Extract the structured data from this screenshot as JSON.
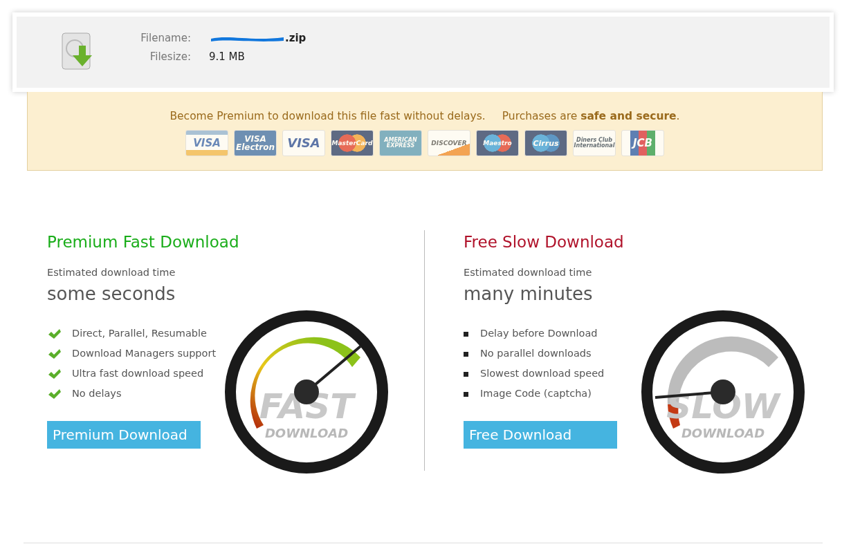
{
  "file": {
    "filename_label": "Filename:",
    "filename": ".zip",
    "filesize_label": "Filesize:",
    "filesize": "9.1 MB"
  },
  "premium_banner": {
    "message": "Become Premium to download this file fast without delays.",
    "security": "Purchases are **safe and secure**.",
    "cards": [
      {
        "kind": "visa-stripe",
        "lines": [
          "VISA"
        ]
      },
      {
        "kind": "visa-electron",
        "lines": [
          "VISA",
          "Electron"
        ]
      },
      {
        "kind": "visa-plain",
        "lines": [
          "VISA"
        ]
      },
      {
        "kind": "mastercard",
        "lines": [
          "MasterCard"
        ]
      },
      {
        "kind": "amex",
        "lines": [
          "AMERICAN",
          "EXPRESS"
        ]
      },
      {
        "kind": "discover",
        "lines": [
          "DISCOVER"
        ]
      },
      {
        "kind": "maestro",
        "lines": [
          "Maestro"
        ]
      },
      {
        "kind": "cirrus",
        "lines": [
          "Cirrus"
        ]
      },
      {
        "kind": "diners",
        "lines": [
          "Diners Club",
          "International"
        ]
      },
      {
        "kind": "jcb",
        "lines": [
          "JCB"
        ]
      }
    ]
  },
  "options": [
    {
      "kind": "fast",
      "title": "Premium Fast Download",
      "color": "#1aad1a",
      "estimate_label": "Estimated download time",
      "estimate": "some seconds",
      "features": [
        "Direct, Parallel, Resumable",
        "Download Managers support",
        "Ultra fast download speed",
        "No delays"
      ],
      "button": "Premium Download",
      "gauge_word": "FAST",
      "gauge_caption": "DOWNLOAD"
    },
    {
      "kind": "slow",
      "title": "Free Slow Download",
      "color": "#b0122a",
      "estimate_label": "Estimated download time",
      "estimate": "many minutes",
      "features": [
        "Delay before Download",
        "No parallel downloads",
        "Slowest download speed",
        "Image Code (captcha)"
      ],
      "button": "Free Download",
      "gauge_word": "SLOW",
      "gauge_caption": "DOWNLOAD"
    }
  ]
}
